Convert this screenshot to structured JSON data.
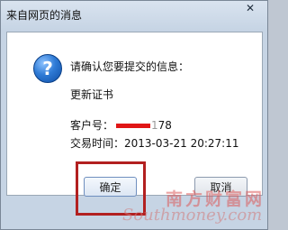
{
  "window": {
    "title": "来自网页的消息",
    "close_glyph": "✕"
  },
  "icon": {
    "name": "question-icon",
    "glyph": "?"
  },
  "message": {
    "line1": "请确认您要提交的信息：",
    "line2": "更新证书",
    "customer_label": "客户号：",
    "customer_value_tail": "78",
    "customer_faded": "1",
    "time_label": "交易时间：",
    "time_value": "2013-03-21 20:27:11"
  },
  "buttons": {
    "ok": "确定",
    "cancel": "取消"
  },
  "watermark": {
    "cn": "南方财富网",
    "en": "Southmoney.com"
  },
  "colors": {
    "highlight": "#b22020",
    "mask": "#e01616"
  }
}
